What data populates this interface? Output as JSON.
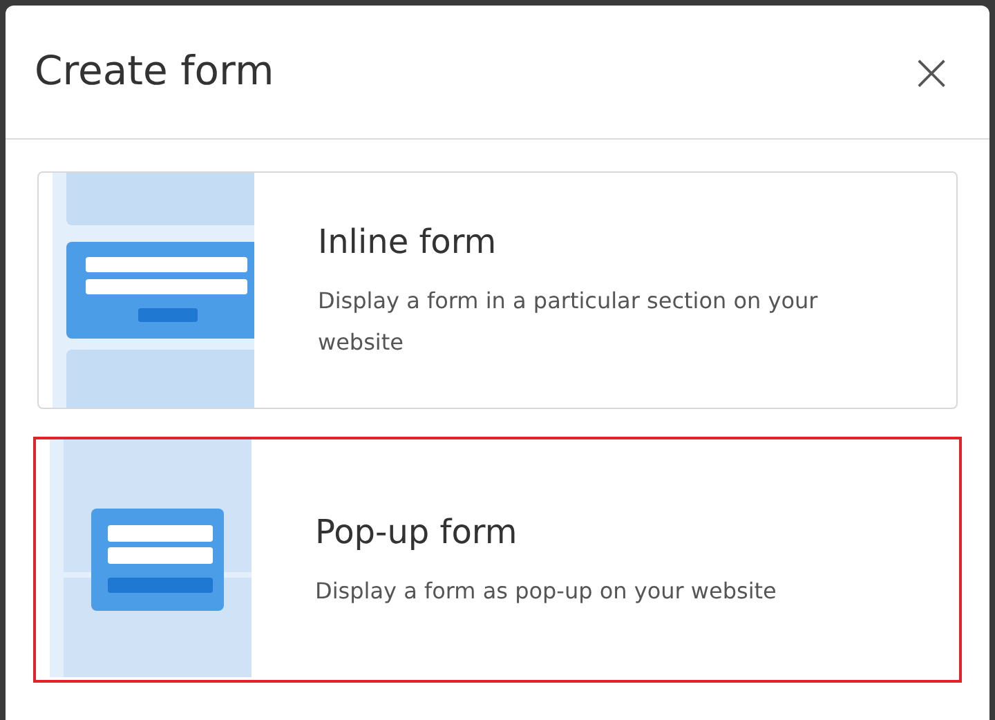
{
  "dialog": {
    "title": "Create form",
    "close": "×"
  },
  "options": [
    {
      "kind": "inline",
      "title": "Inline form",
      "description": "Display a form in a particular section on your website",
      "selected": false
    },
    {
      "kind": "popup",
      "title": "Pop-up form",
      "description": "Display a form as pop-up on your website",
      "selected": true
    }
  ]
}
